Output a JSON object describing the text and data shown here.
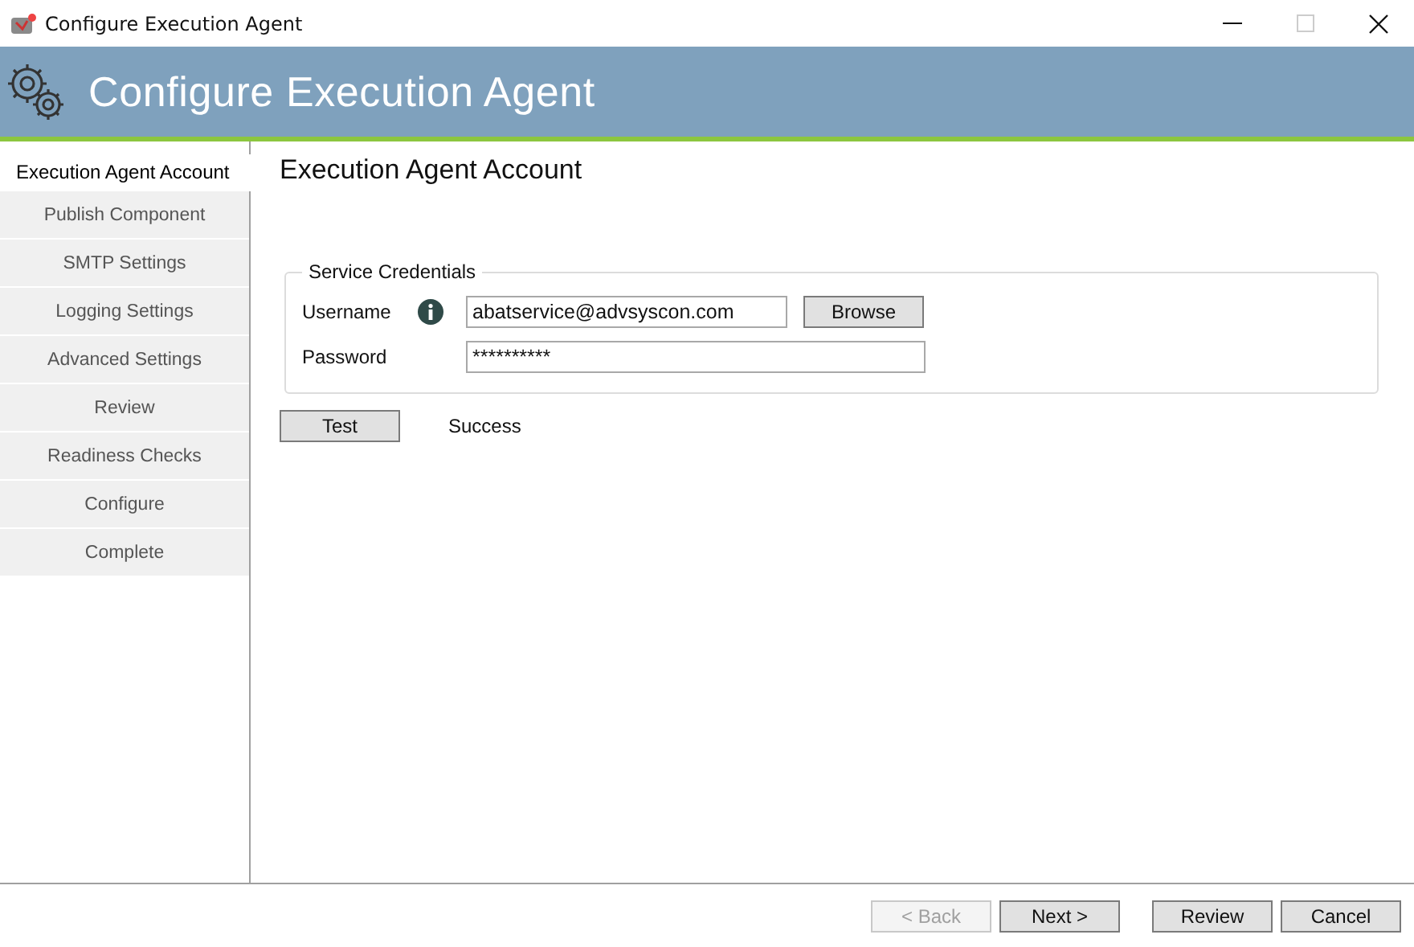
{
  "window": {
    "title": "Configure Execution Agent",
    "maximize_disabled": true
  },
  "header": {
    "title": "Configure Execution Agent"
  },
  "sidebar": {
    "items": [
      {
        "label": "Execution Agent Account",
        "selected": true
      },
      {
        "label": "Publish Component",
        "selected": false
      },
      {
        "label": "SMTP Settings",
        "selected": false
      },
      {
        "label": "Logging Settings",
        "selected": false
      },
      {
        "label": "Advanced Settings",
        "selected": false
      },
      {
        "label": "Review",
        "selected": false
      },
      {
        "label": "Readiness Checks",
        "selected": false
      },
      {
        "label": "Configure",
        "selected": false
      },
      {
        "label": "Complete",
        "selected": false
      }
    ]
  },
  "page": {
    "title": "Execution Agent Account",
    "group": {
      "title": "Service Credentials",
      "username": {
        "label": "Username",
        "value": "abatservice@advsyscon.com",
        "button": "Browse"
      },
      "password": {
        "label": "Password",
        "value": "**********"
      }
    },
    "test_button": "Test",
    "test_result": "Success"
  },
  "footer": {
    "buttons": [
      {
        "label": "< Back",
        "disabled": true
      },
      {
        "label": "Next >",
        "disabled": false
      },
      {
        "label": "Review",
        "disabled": false
      },
      {
        "label": "Cancel",
        "disabled": false
      }
    ]
  }
}
